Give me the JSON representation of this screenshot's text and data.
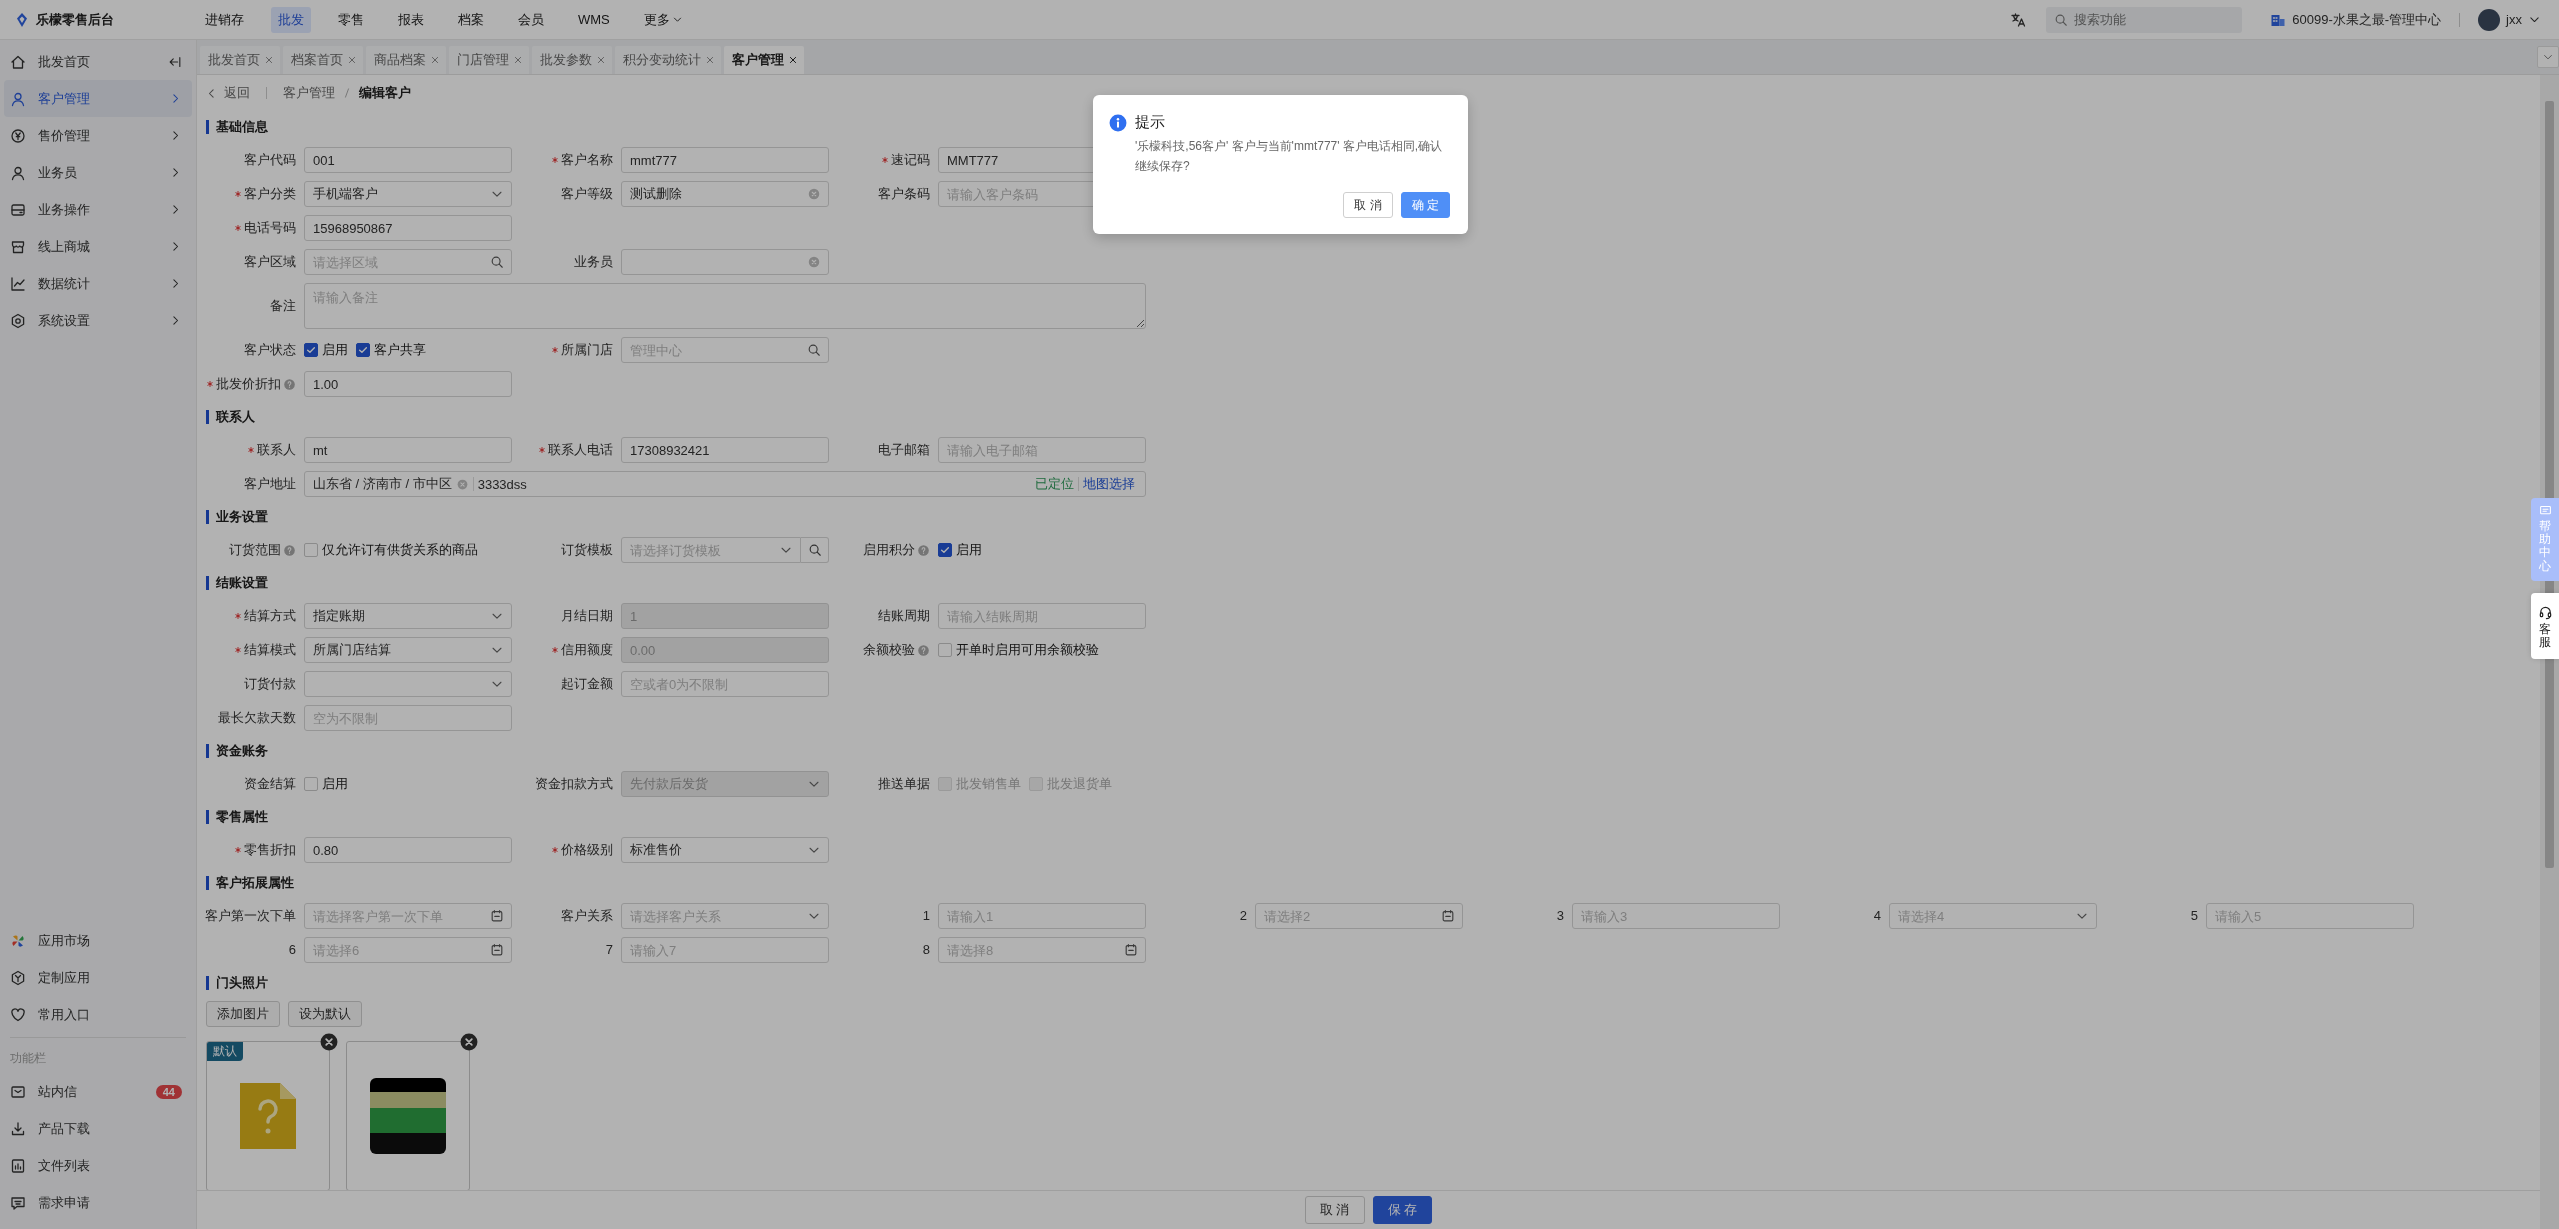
{
  "topbar": {
    "title": "乐檬零售后台",
    "nav": [
      {
        "label": "进销存",
        "selected": false,
        "kind": "link"
      },
      {
        "label": "批发",
        "selected": true,
        "kind": "link"
      },
      {
        "label": "零售",
        "selected": false,
        "kind": "link"
      },
      {
        "label": "报表",
        "selected": false,
        "kind": "link"
      },
      {
        "label": "档案",
        "selected": false,
        "kind": "link"
      },
      {
        "label": "会员",
        "selected": false,
        "kind": "link"
      },
      {
        "label": "WMS",
        "selected": false,
        "kind": "link"
      },
      {
        "label": "更多",
        "selected": false,
        "kind": "menu"
      }
    ],
    "search": {
      "placeholder": "搜索功能"
    },
    "org": "60099-水果之最-管理中心",
    "user": "jxx"
  },
  "sidebar": {
    "items": [
      {
        "label": "批发首页",
        "selected": false,
        "expandable": false
      },
      {
        "label": "客户管理",
        "selected": true,
        "expandable": true
      },
      {
        "label": "售价管理",
        "selected": false,
        "expandable": true
      },
      {
        "label": "业务员",
        "selected": false,
        "expandable": true
      },
      {
        "label": "业务操作",
        "selected": false,
        "expandable": true
      },
      {
        "label": "线上商城",
        "selected": false,
        "expandable": true
      },
      {
        "label": "数据统计",
        "selected": false,
        "expandable": true
      },
      {
        "label": "系统设置",
        "selected": false,
        "expandable": true
      }
    ],
    "apps": [
      {
        "label": "应用市场"
      },
      {
        "label": "定制应用"
      },
      {
        "label": "常用入口"
      }
    ],
    "tools_title": "功能栏",
    "tools": [
      {
        "label": "站内信",
        "badge": "44"
      },
      {
        "label": "产品下载"
      },
      {
        "label": "文件列表"
      },
      {
        "label": "需求申请"
      }
    ]
  },
  "tabs": [
    {
      "label": "批发首页",
      "selected": false
    },
    {
      "label": "档案首页",
      "selected": false
    },
    {
      "label": "商品档案",
      "selected": false
    },
    {
      "label": "门店管理",
      "selected": false
    },
    {
      "label": "批发参数",
      "selected": false
    },
    {
      "label": "积分变动统计",
      "selected": false
    },
    {
      "label": "客户管理",
      "selected": true
    }
  ],
  "breadcrumb": {
    "back": "返回",
    "path": [
      "客户管理",
      "编辑客户"
    ]
  },
  "sections": [
    {
      "title": "基础信息",
      "rows": [
        [
          {
            "label": "客户代码",
            "kind": "text",
            "value": "001",
            "required": false,
            "help": false,
            "disabled": false
          },
          {
            "label": "客户名称",
            "kind": "text",
            "value": "mmt777",
            "required": true,
            "help": false,
            "disabled": false
          },
          {
            "label": "速记码",
            "kind": "text",
            "value": "MMT777",
            "required": true,
            "help": false,
            "disabled": false
          }
        ],
        [
          {
            "label": "客户分类",
            "kind": "select",
            "value": "手机端客户",
            "required": true,
            "help": false,
            "disabled": false
          },
          {
            "label": "客户等级",
            "kind": "clear-select",
            "value": "测试删除",
            "required": false,
            "help": false,
            "disabled": false
          },
          {
            "label": "客户条码",
            "kind": "text",
            "placeholder": "请输入客户条码",
            "required": false,
            "help": false,
            "disabled": false
          }
        ],
        [
          {
            "label": "电话号码",
            "kind": "text",
            "value": "15968950867",
            "required": true,
            "help": false,
            "disabled": false
          }
        ],
        [
          {
            "label": "客户区域",
            "kind": "search",
            "placeholder": "请选择区域",
            "required": false,
            "help": false,
            "disabled": false
          },
          {
            "label": "业务员",
            "kind": "clear-select",
            "required": false,
            "help": false,
            "disabled": false
          }
        ],
        [
          {
            "label": "备注",
            "kind": "textarea",
            "placeholder": "请输入备注",
            "required": false,
            "help": false,
            "disabled": false
          }
        ],
        [
          {
            "label": "客户状态",
            "kind": "checks",
            "required": false,
            "help": false,
            "options": [
              {
                "label": "启用",
                "checked": true,
                "disabled": false
              },
              {
                "label": "客户共享",
                "checked": true,
                "disabled": false
              }
            ]
          },
          {
            "label": "所属门店",
            "kind": "search",
            "placeholder": "管理中心",
            "required": true,
            "help": false,
            "disabled": false
          }
        ],
        [
          {
            "label": "批发价折扣",
            "kind": "text",
            "value": "1.00",
            "required": true,
            "help": true,
            "disabled": false
          }
        ]
      ]
    },
    {
      "title": "联系人",
      "rows": [
        [
          {
            "label": "联系人",
            "kind": "text",
            "value": "mt",
            "required": true,
            "help": false,
            "disabled": false
          },
          {
            "label": "联系人电话",
            "kind": "text",
            "value": "17308932421",
            "required": true,
            "help": false,
            "disabled": false
          },
          {
            "label": "电子邮箱",
            "kind": "text",
            "placeholder": "请输入电子邮箱",
            "required": false,
            "help": false,
            "disabled": false
          }
        ],
        [
          {
            "label": "客户地址",
            "kind": "address",
            "region": "山东省 / 济南市 / 市中区",
            "detail": "3333dss",
            "status": "已定位",
            "link": "地图选择",
            "required": false,
            "help": false
          }
        ]
      ]
    },
    {
      "title": "业务设置",
      "rows": [
        [
          {
            "label": "订货范围",
            "kind": "checks",
            "required": false,
            "help": true,
            "options": [
              {
                "label": "仅允许订有供货关系的商品",
                "checked": false,
                "disabled": false
              }
            ]
          },
          {
            "label": "订货模板",
            "kind": "select-search",
            "placeholder": "请选择订货模板",
            "required": false,
            "help": false,
            "disabled": false
          },
          {
            "label": "启用积分",
            "kind": "checks",
            "required": false,
            "help": true,
            "options": [
              {
                "label": "启用",
                "checked": true,
                "disabled": false
              }
            ]
          }
        ]
      ]
    },
    {
      "title": "结账设置",
      "rows": [
        [
          {
            "label": "结算方式",
            "kind": "select",
            "value": "指定账期",
            "required": true,
            "help": false,
            "disabled": false
          },
          {
            "label": "月结日期",
            "kind": "text",
            "value": "1",
            "required": false,
            "help": false,
            "disabled": true
          },
          {
            "label": "结账周期",
            "kind": "text",
            "placeholder": "请输入结账周期",
            "required": false,
            "help": false,
            "disabled": false
          }
        ],
        [
          {
            "label": "结算模式",
            "kind": "select",
            "value": "所属门店结算",
            "required": true,
            "help": false,
            "disabled": false
          },
          {
            "label": "信用额度",
            "kind": "text",
            "value": "0.00",
            "required": true,
            "help": false,
            "disabled": true
          },
          {
            "label": "余额校验",
            "kind": "checks",
            "required": false,
            "help": true,
            "options": [
              {
                "label": "开单时启用可用余额校验",
                "checked": false,
                "disabled": false
              }
            ]
          }
        ],
        [
          {
            "label": "订货付款",
            "kind": "select",
            "required": false,
            "help": false,
            "disabled": false
          },
          {
            "label": "起订金额",
            "kind": "text",
            "placeholder": "空或者0为不限制",
            "required": false,
            "help": false,
            "disabled": false
          }
        ],
        [
          {
            "label": "最长欠款天数",
            "kind": "text",
            "placeholder": "空为不限制",
            "required": false,
            "help": false,
            "disabled": false
          }
        ]
      ]
    },
    {
      "title": "资金账务",
      "rows": [
        [
          {
            "label": "资金结算",
            "kind": "checks",
            "required": false,
            "help": false,
            "options": [
              {
                "label": "启用",
                "checked": false,
                "disabled": false
              }
            ]
          },
          {
            "label": "资金扣款方式",
            "kind": "select",
            "value": "先付款后发货",
            "required": false,
            "help": false,
            "disabled": true
          },
          {
            "label": "推送单据",
            "kind": "checks",
            "required": false,
            "help": false,
            "options": [
              {
                "label": "批发销售单",
                "checked": false,
                "disabled": true
              },
              {
                "label": "批发退货单",
                "checked": false,
                "disabled": true
              }
            ]
          }
        ]
      ]
    },
    {
      "title": "零售属性",
      "rows": [
        [
          {
            "label": "零售折扣",
            "kind": "text",
            "value": "0.80",
            "required": true,
            "help": false,
            "disabled": false
          },
          {
            "label": "价格级别",
            "kind": "select",
            "value": "标准售价",
            "required": true,
            "help": false,
            "disabled": false
          }
        ]
      ]
    },
    {
      "title": "客户拓展属性",
      "rows": [
        [
          {
            "label": "客户第一次下单",
            "kind": "date",
            "placeholder": "请选择客户第一次下单",
            "required": false,
            "help": false,
            "disabled": false
          },
          {
            "label": "客户关系",
            "kind": "select",
            "placeholder": "请选择客户关系",
            "required": false,
            "help": false,
            "disabled": false
          },
          {
            "label": "1",
            "kind": "text",
            "placeholder": "请输入1",
            "required": false,
            "help": false,
            "disabled": false
          },
          {
            "label": "2",
            "kind": "date",
            "placeholder": "请选择2",
            "required": false,
            "help": false,
            "disabled": false
          },
          {
            "label": "3",
            "kind": "text",
            "placeholder": "请输入3",
            "required": false,
            "help": false,
            "disabled": false
          },
          {
            "label": "4",
            "kind": "select",
            "placeholder": "请选择4",
            "required": false,
            "help": false,
            "disabled": false
          },
          {
            "label": "5",
            "kind": "text",
            "placeholder": "请输入5",
            "required": false,
            "help": false,
            "disabled": false
          }
        ],
        [
          {
            "label": "6",
            "kind": "date",
            "placeholder": "请选择6",
            "required": false,
            "help": false,
            "disabled": false
          },
          {
            "label": "7",
            "kind": "text",
            "placeholder": "请输入7",
            "required": false,
            "help": false,
            "disabled": false
          },
          {
            "label": "8",
            "kind": "date",
            "placeholder": "请选择8",
            "required": false,
            "help": false,
            "disabled": false
          }
        ]
      ]
    }
  ],
  "photos": {
    "title": "门头照片",
    "buttons": [
      "添加图片",
      "设为默认"
    ],
    "items": [
      {
        "kind": "file",
        "badge": "默认"
      },
      {
        "kind": "image"
      }
    ]
  },
  "footer": {
    "buttons": [
      {
        "label": "取 消",
        "primary": false
      },
      {
        "label": "保 存",
        "primary": true
      }
    ]
  },
  "dialog": {
    "title": "提示",
    "message": "'乐檬科技,56客户' 客户与当前'mmt777' 客户电话相同,确认继续保存?",
    "buttons": [
      {
        "label": "取 消",
        "primary": false
      },
      {
        "label": "确 定",
        "primary": true
      }
    ]
  },
  "float": {
    "help": "帮助中心",
    "service": "客服"
  }
}
